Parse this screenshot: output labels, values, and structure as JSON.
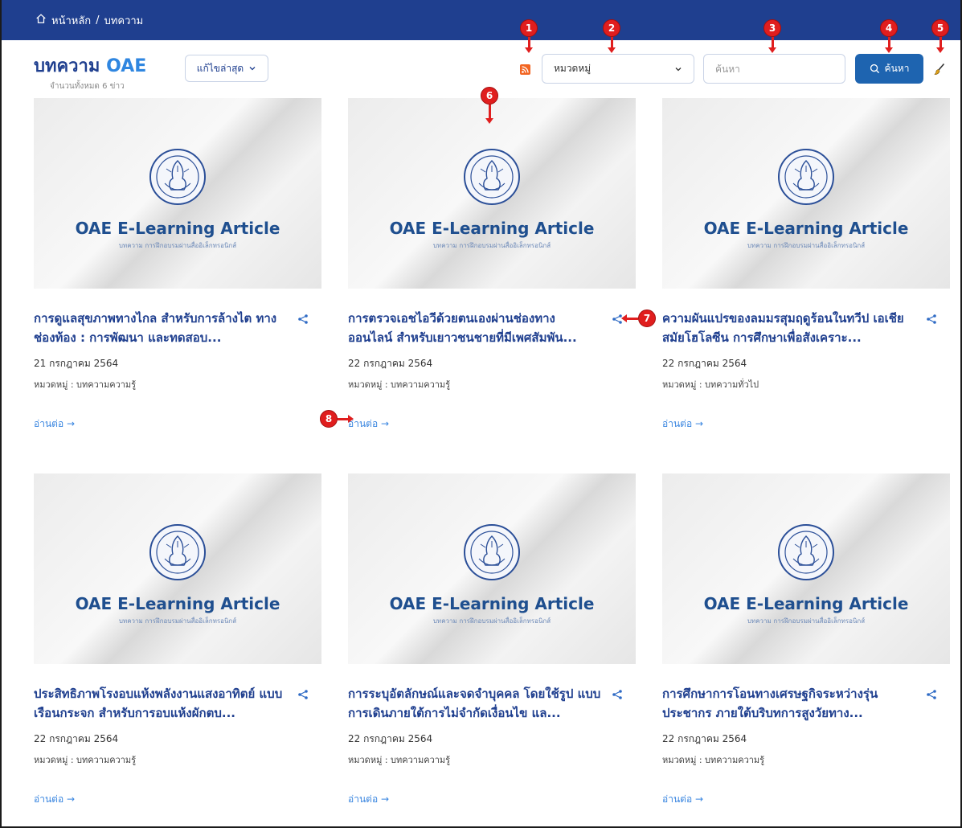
{
  "breadcrumb": {
    "home": "หน้าหลัก",
    "separator": "/",
    "current": "บทความ"
  },
  "header": {
    "title_main": "บทความ",
    "title_accent": "OAE",
    "subtitle": "จำนวนทั้งหมด 6 ข่าว",
    "sort_label": "แก้ไขล่าสุด",
    "category_label": "หมวดหมู่",
    "search_placeholder": "ค้นหา",
    "search_button": "ค้นหา"
  },
  "thumbnail": {
    "title": "OAE E-Learning Article",
    "subtitle": "บทความ การฝึกอบรมผ่านสื่ออิเล็กทรอนิกส์"
  },
  "read_more": "อ่านต่อ →",
  "articles": [
    {
      "title": "การดูแลสุขภาพทางไกล สำหรับการล้างไต ทางช่องท้อง : การพัฒนา และทดสอบ...",
      "date": "21 กรกฎาคม 2564",
      "category": "หมวดหมู่ : บทความความรู้"
    },
    {
      "title": "การตรวจเอชไอวีด้วยตนเองผ่านช่องทาง ออนไลน์ สำหรับเยาวชนชายที่มีเพศสัมพัน...",
      "date": "22 กรกฎาคม 2564",
      "category": "หมวดหมู่ : บทความความรู้"
    },
    {
      "title": "ความผันแปรของลมมรสุมฤดูร้อนในทวีป เอเชียสมัยโฮโลซีน การศึกษาเพื่อสังเคราะ...",
      "date": "22 กรกฎาคม 2564",
      "category": "หมวดหมู่ : บทความทั่วไป"
    },
    {
      "title": "ประสิทธิภาพโรงอบแห้งพลังงานแสงอาทิตย์ แบบเรือนกระจก สำหรับการอบแห้งผักตบ...",
      "date": "22 กรกฎาคม 2564",
      "category": "หมวดหมู่ : บทความความรู้"
    },
    {
      "title": "การระบุอัตลักษณ์และจดจำบุคคล โดยใช้รูป แบบการเดินภายใต้การไม่จำกัดเงื่อนไข แล...",
      "date": "22 กรกฎาคม 2564",
      "category": "หมวดหมู่ : บทความความรู้"
    },
    {
      "title": "การศึกษาการโอนทางเศรษฐกิจระหว่างรุ่น ประชากร ภายใต้บริบทการสูงวัยทาง...",
      "date": "22 กรกฎาคม 2564",
      "category": "หมวดหมู่ : บทความความรู้"
    }
  ],
  "markers": [
    "1",
    "2",
    "3",
    "4",
    "5",
    "6",
    "7",
    "8"
  ],
  "colors": {
    "nav": "#1f3f8f",
    "accent": "#2f86e0",
    "button": "#1e64b0",
    "rss": "#f26522",
    "marker": "#e01e1e"
  },
  "icons": {
    "home": "home-icon",
    "rss": "rss-icon",
    "chevron": "chevron-down-icon",
    "search": "search-icon",
    "brush": "brush-icon",
    "share": "share-icon",
    "seal": "seal-emblem"
  }
}
